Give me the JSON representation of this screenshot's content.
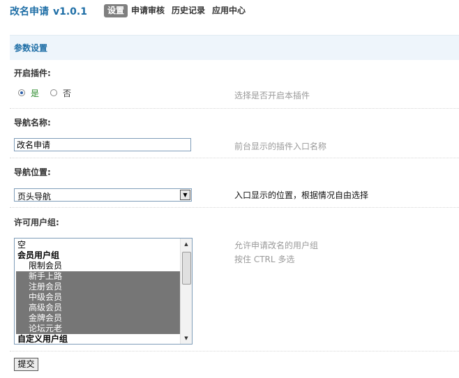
{
  "header": {
    "title": "改名申请",
    "version": "v1.0.1",
    "tabs": [
      {
        "label": "设置",
        "active": true
      },
      {
        "label": "申请审核",
        "active": false
      },
      {
        "label": "历史记录",
        "active": false
      },
      {
        "label": "应用中心",
        "active": false
      }
    ]
  },
  "section": {
    "title": "参数设置"
  },
  "enable_plugin": {
    "label": "开启插件:",
    "options": [
      {
        "label": "是",
        "checked": true
      },
      {
        "label": "否",
        "checked": false
      }
    ],
    "hint": "选择是否开启本插件"
  },
  "nav_name": {
    "label": "导航名称:",
    "value": "改名申请",
    "hint": "前台显示的插件入口名称"
  },
  "nav_position": {
    "label": "导航位置:",
    "selected": "页头导航",
    "hint": "入口显示的位置，根据情况自由选择"
  },
  "user_groups": {
    "label": "许可用户组:",
    "items": [
      {
        "label": "空",
        "type": "option",
        "selected": false
      },
      {
        "label": "会员用户组",
        "type": "group",
        "selected": false
      },
      {
        "label": "限制会员",
        "type": "sub",
        "selected": false
      },
      {
        "label": "新手上路",
        "type": "sub",
        "selected": true
      },
      {
        "label": "注册会员",
        "type": "sub",
        "selected": true
      },
      {
        "label": "中级会员",
        "type": "sub",
        "selected": true
      },
      {
        "label": "高级会员",
        "type": "sub",
        "selected": true
      },
      {
        "label": "金牌会员",
        "type": "sub",
        "selected": true
      },
      {
        "label": "论坛元老",
        "type": "sub",
        "selected": true
      },
      {
        "label": "自定义用户组",
        "type": "group",
        "selected": false
      }
    ],
    "hint_line1": "允许申请改名的用户组",
    "hint_line2": "按住 CTRL 多选"
  },
  "submit_label": "提交",
  "colors": {
    "accent": "#1e6ea6",
    "section_bg": "#eef5fb",
    "selected_option_bg": "#767676",
    "active_tab_bg": "#7f7f7f"
  }
}
